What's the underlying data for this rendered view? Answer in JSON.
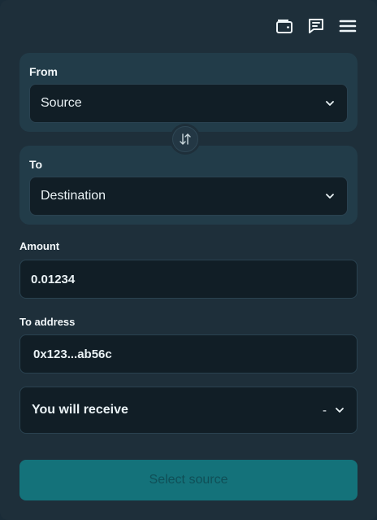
{
  "header": {
    "icons": [
      "wallet-icon",
      "message-icon",
      "menu-icon"
    ]
  },
  "from": {
    "label": "From",
    "value": "Source"
  },
  "to": {
    "label": "To",
    "value": "Destination"
  },
  "amount": {
    "label": "Amount",
    "value": "0.01234"
  },
  "address": {
    "label": "To address",
    "value": "0x123...ab56c"
  },
  "receive": {
    "label": "You will receive",
    "value": "-"
  },
  "submit": {
    "label": "Select source"
  },
  "colors": {
    "accent": "#14727a",
    "panel": "#223c49",
    "field": "#111e26"
  }
}
